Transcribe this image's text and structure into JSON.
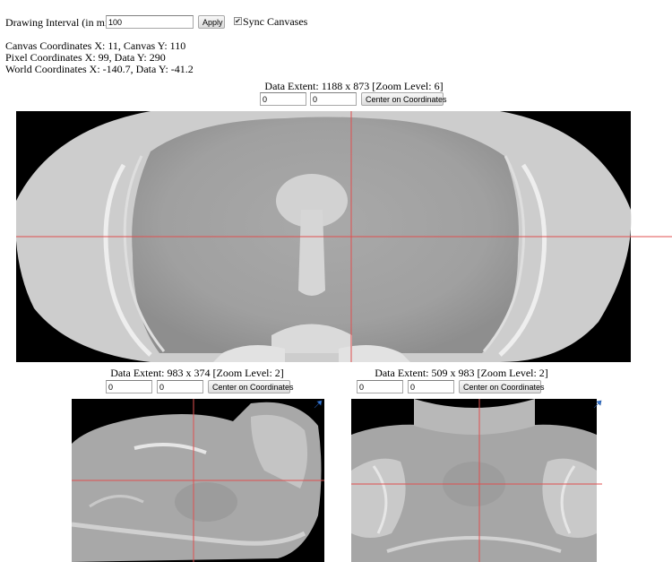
{
  "controls": {
    "interval_label": "Drawing Interval (in millis):",
    "interval_value": "100",
    "apply_label": "Apply",
    "sync_label": "Sync Canvases",
    "sync_checked": true
  },
  "readouts": {
    "canvas": "Canvas Coordinates X: 11, Canvas Y: 110",
    "pixel": "Pixel Coordinates X: 99, Data Y: 290",
    "world": "World Coordinates X: -140.7, Data Y: -41.2"
  },
  "viewers": [
    {
      "extent": "Data Extent: 1188 x 873 [Zoom Level: 6]",
      "x_value": "0",
      "y_value": "0",
      "center_label": "Center on Coordinates",
      "view": "coronal"
    },
    {
      "extent": "Data Extent: 983 x 374 [Zoom Level: 2]",
      "x_value": "0",
      "y_value": "0",
      "center_label": "Center on Coordinates",
      "view": "sagittal",
      "corner_icon": "arrow-icon"
    },
    {
      "extent": "Data Extent: 509 x 983 [Zoom Level: 2]",
      "x_value": "0",
      "y_value": "0",
      "center_label": "Center on Coordinates",
      "view": "horizontal",
      "corner_icon": "arrow-icon"
    }
  ],
  "colors": {
    "crosshair": "#e05050",
    "canvas_bg": "#000000",
    "corner_icon": "#3a7bd5"
  }
}
